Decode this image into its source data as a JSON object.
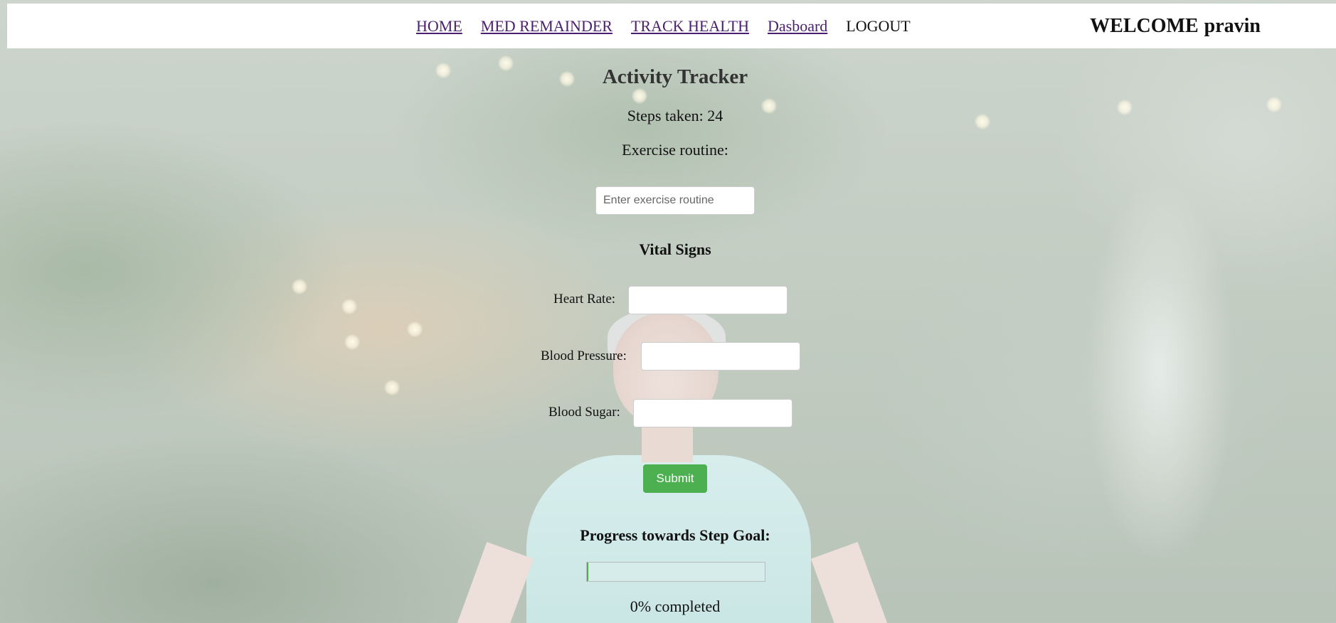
{
  "nav": {
    "items": [
      {
        "label": "HOME"
      },
      {
        "label": "MED REMAINDER"
      },
      {
        "label": "TRACK HEALTH"
      },
      {
        "label": "Dasboard"
      }
    ],
    "logout_label": "LOGOUT",
    "welcome_text": "WELCOME",
    "username": "pravin"
  },
  "activity": {
    "title": "Activity Tracker",
    "steps_text": "Steps taken: 24",
    "routine_label": "Exercise routine:",
    "routine_placeholder": "Enter exercise routine",
    "routine_value": ""
  },
  "vitals": {
    "title": "Vital Signs",
    "heart_rate_label": "Heart Rate:",
    "heart_rate_value": "",
    "blood_pressure_label": "Blood Pressure:",
    "blood_pressure_value": "",
    "blood_sugar_label": "Blood Sugar:",
    "blood_sugar_value": ""
  },
  "submit_label": "Submit",
  "progress": {
    "title": "Progress towards Step Goal:",
    "percent": 0,
    "completed_text": "0% completed"
  },
  "colors": {
    "submit_button": "#4caf50",
    "progress_fill": "#4caf50",
    "nav_link": "#4b1f6f"
  }
}
